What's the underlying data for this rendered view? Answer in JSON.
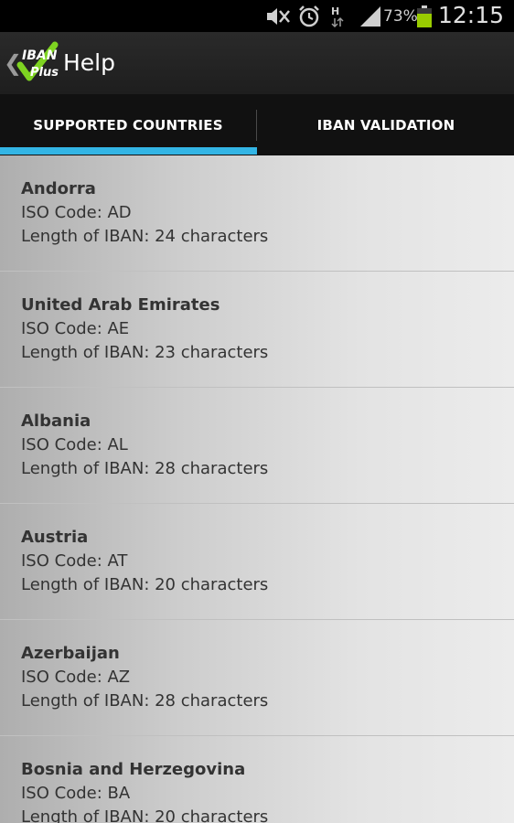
{
  "status_bar": {
    "battery_percent": "73%",
    "time": "12:15",
    "icons": [
      "mute-icon",
      "alarm-icon",
      "hspa-data-icon",
      "signal-icon",
      "battery-icon"
    ]
  },
  "action_bar": {
    "back_glyph": "❮",
    "logo": {
      "line1": "IBAN",
      "line2": "Plus"
    },
    "title": "Help"
  },
  "tabs": [
    {
      "label": "SUPPORTED COUNTRIES",
      "selected": true
    },
    {
      "label": "IBAN VALIDATION",
      "selected": false
    }
  ],
  "colors": {
    "accent": "#33b5e5",
    "logo_check": "#7ed321"
  },
  "countries": [
    {
      "name": "Andorra",
      "iso": "ISO Code: AD",
      "length": "Length of IBAN: 24 characters"
    },
    {
      "name": "United Arab Emirates",
      "iso": "ISO Code: AE",
      "length": "Length of IBAN: 23 characters"
    },
    {
      "name": "Albania",
      "iso": "ISO Code: AL",
      "length": "Length of IBAN: 28 characters"
    },
    {
      "name": "Austria",
      "iso": "ISO Code: AT",
      "length": "Length of IBAN: 20 characters"
    },
    {
      "name": "Azerbaijan",
      "iso": "ISO Code: AZ",
      "length": "Length of IBAN: 28 characters"
    },
    {
      "name": "Bosnia and Herzegovina",
      "iso": "ISO Code: BA",
      "length": "Length of IBAN: 20 characters"
    }
  ]
}
